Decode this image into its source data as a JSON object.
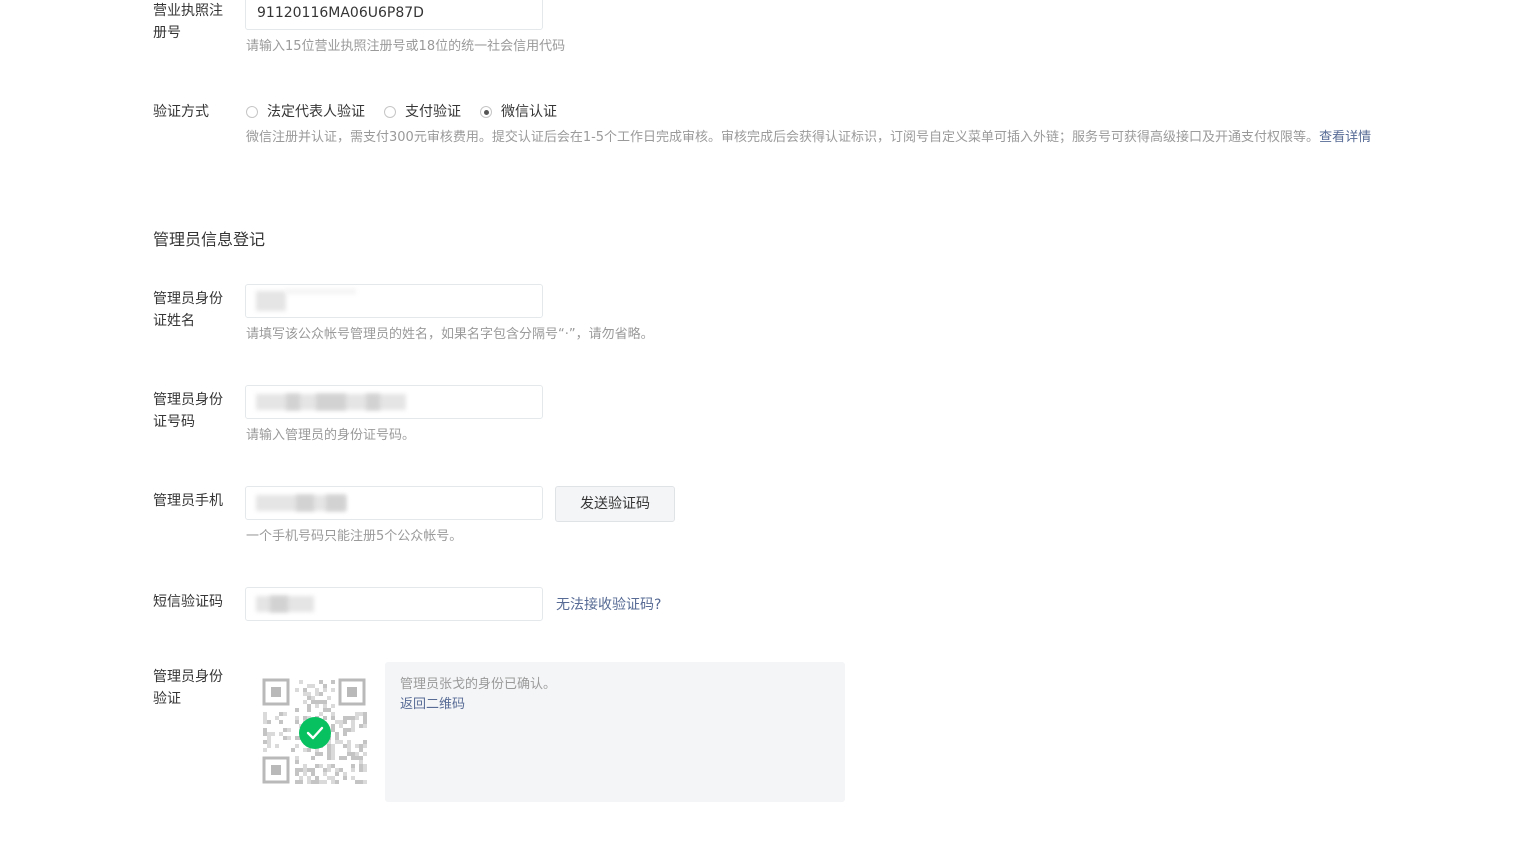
{
  "business_license": {
    "label": "营业执照注册号",
    "value": "91120116MA06U6P87D",
    "tip": "请输入15位营业执照注册号或18位的统一社会信用代码"
  },
  "verify_method": {
    "label": "验证方式",
    "options": [
      "法定代表人验证",
      "支付验证",
      "微信认证"
    ],
    "selected": "微信认证",
    "tip": "微信注册并认证，需支付300元审核费用。提交认证后会在1-5个工作日完成审核。审核完成后会获得认证标识，订阅号自定义菜单可插入外链；服务号可获得高级接口及开通支付权限等。",
    "tip_link": "查看详情"
  },
  "admin_section": {
    "title": "管理员信息登记"
  },
  "admin_name": {
    "label": "管理员身份证姓名",
    "tip": "请填写该公众帐号管理员的姓名，如果名字包含分隔号“·”，请勿省略。"
  },
  "admin_id": {
    "label": "管理员身份证号码",
    "tip": "请输入管理员的身份证号码。"
  },
  "admin_phone": {
    "label": "管理员手机",
    "send_button": "发送验证码",
    "tip": "一个手机号码只能注册5个公众帐号。"
  },
  "sms_code": {
    "label": "短信验证码",
    "help_link": "无法接收验证码?"
  },
  "admin_verify": {
    "label": "管理员身份验证",
    "confirmed_text": "管理员张戈的身份已确认。",
    "back_link": "返回二维码"
  },
  "icons": {
    "qr": "qr-code-icon",
    "success": "check-circle-icon"
  },
  "colors": {
    "link": "#576b95",
    "success": "#07c160"
  }
}
